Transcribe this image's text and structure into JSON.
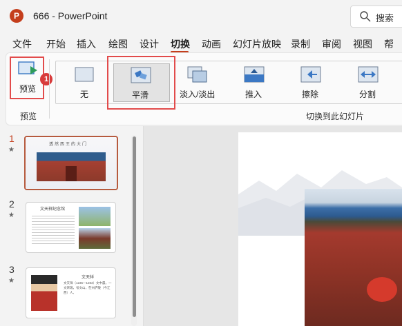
{
  "title_bar": {
    "app_icon": "P",
    "title": "666  -  PowerPoint",
    "search_placeholder": "搜索"
  },
  "tabs": [
    "文件",
    "开始",
    "插入",
    "绘图",
    "设计",
    "切换",
    "动画",
    "幻灯片放映",
    "录制",
    "审阅",
    "视图",
    "帮助"
  ],
  "active_tab": "切换",
  "ribbon": {
    "preview_label": "预览",
    "preview_group": "预览",
    "transitions": [
      "无",
      "平滑",
      "淡入/淡出",
      "推入",
      "擦除",
      "分割"
    ],
    "transition_group": "切换到此幻灯片",
    "selected_transition": "平滑",
    "callout_badge": "1"
  },
  "slides": [
    {
      "number": "1",
      "title": "透然西王的大门"
    },
    {
      "number": "2",
      "title": "文天祥纪念馆"
    },
    {
      "number": "3",
      "title": "文天祥",
      "subtitle": "文天祥（1236—1283）文中晨，一文宋瑞，号文山，在州庐陵（今江西）人。"
    }
  ],
  "colors": {
    "accent": "#c43e1c",
    "highlight_box": "#e24b4b",
    "selected_slide_border": "#b65a3e"
  }
}
